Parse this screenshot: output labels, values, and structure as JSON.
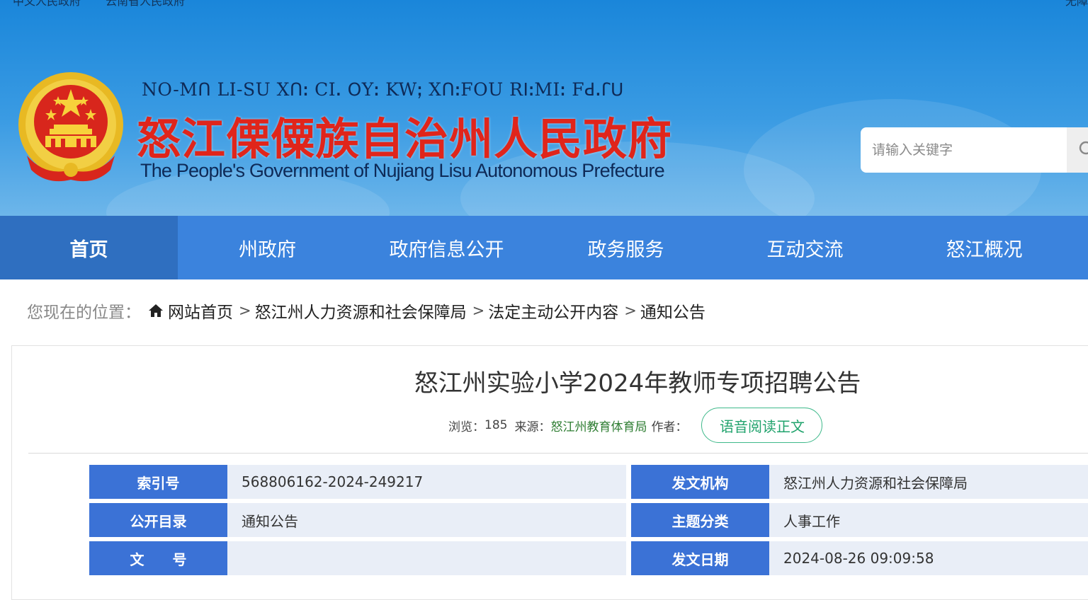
{
  "top_bar": {
    "left_links": [
      "中文人民政府",
      "云南省人民政府"
    ],
    "right_text": "无障"
  },
  "header": {
    "lisu_text": "NO-Mꓵ LI-SU Xꓵꓽ CIꓸ ꓳYꓽ KWꓼ XꓵꓽFOU RꓲꓽMIꓽ Fꓒꓸꓩꓴ",
    "cn_title": "怒江傈僳族自治州人民政府",
    "en_title": "The People's Government of Nujiang Lisu Autonomous Prefecture"
  },
  "search": {
    "placeholder": "请输入关键字"
  },
  "nav": {
    "items": [
      {
        "label": "首页",
        "active": true
      },
      {
        "label": "州政府",
        "active": false
      },
      {
        "label": "政府信息公开",
        "active": false
      },
      {
        "label": "政务服务",
        "active": false
      },
      {
        "label": "互动交流",
        "active": false
      },
      {
        "label": "怒江概况",
        "active": false
      }
    ]
  },
  "breadcrumb": {
    "label": "您现在的位置：",
    "items": [
      "网站首页",
      "怒江州人力资源和社会保障局",
      "法定主动公开内容",
      "通知公告"
    ],
    "separator": ">"
  },
  "article": {
    "title": "怒江州实验小学2024年教师专项招聘公告",
    "views_label": "浏览：",
    "views": "185",
    "source_label": "来源：",
    "source": "怒江州教育体育局",
    "author_label": "作者：",
    "voice_button": "语音阅读正文"
  },
  "info_table": {
    "rows": [
      {
        "k1": "索引号",
        "v1": "568806162-2024-249217",
        "k2": "发文机构",
        "v2": "怒江州人力资源和社会保障局"
      },
      {
        "k1": "公开目录",
        "v1": "通知公告",
        "k2": "主题分类",
        "v2": "人事工作"
      },
      {
        "k1": "文　　号",
        "v1": "",
        "k2": "发文日期",
        "v2": "2024-08-26 09:09:58"
      }
    ]
  },
  "colors": {
    "nav_bg": "#3b83dd",
    "nav_active": "#2f6fc0",
    "title_red": "#e0251b",
    "key_blue": "#3b72d6",
    "value_bg": "#e9eef7",
    "voice_green": "#21a36d"
  }
}
